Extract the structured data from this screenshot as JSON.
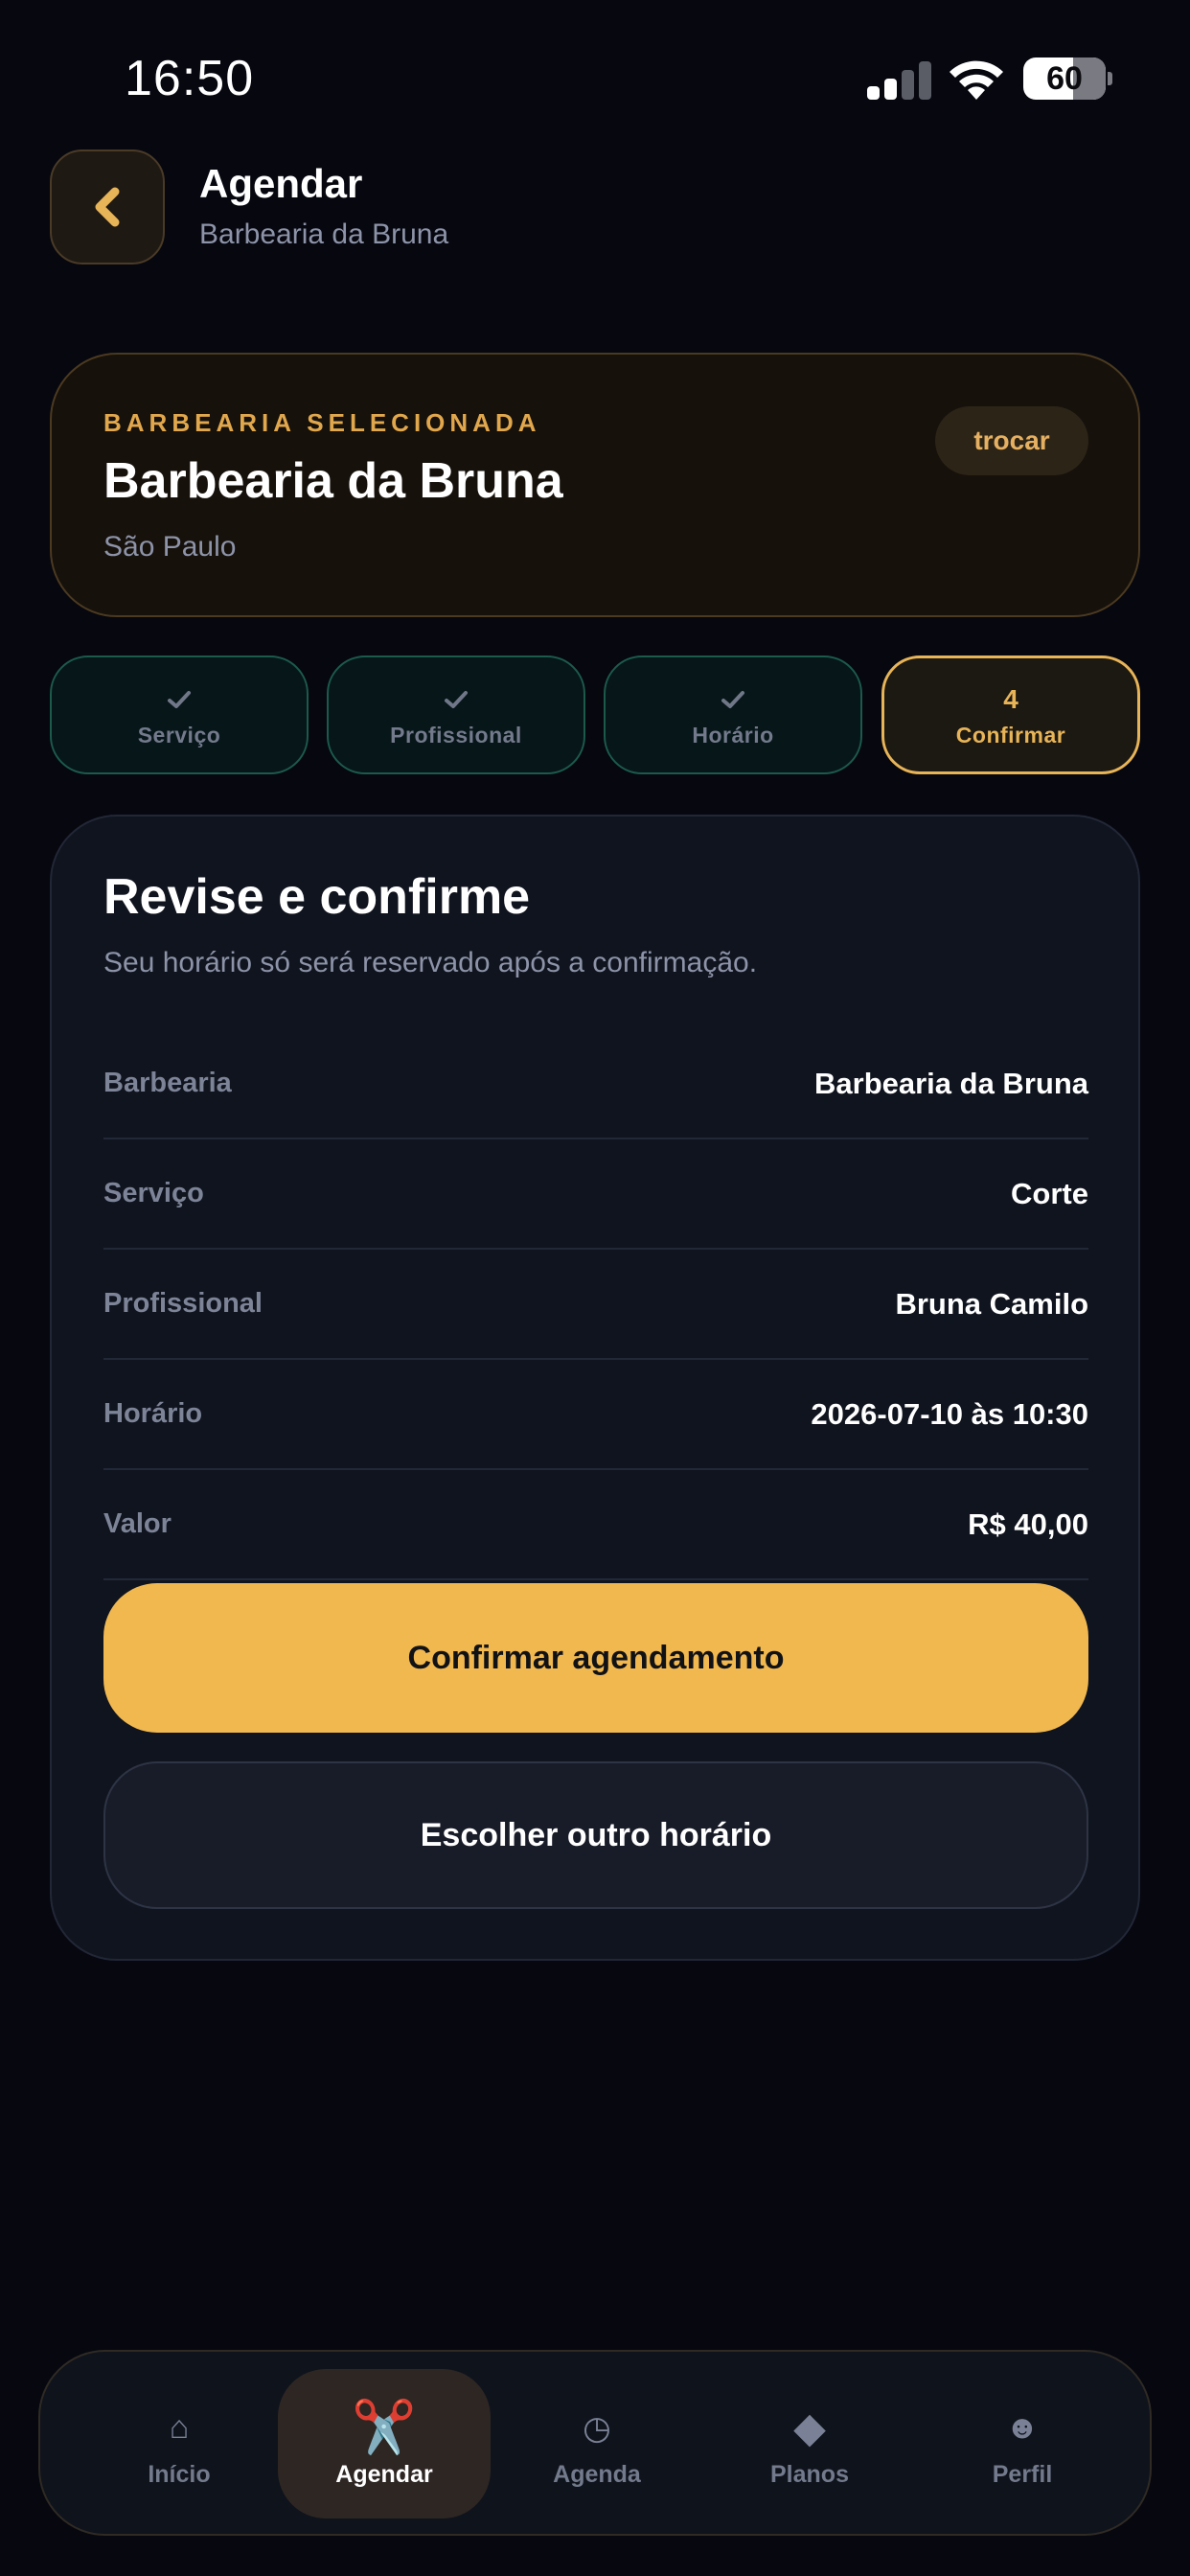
{
  "status_bar": {
    "time": "16:50",
    "battery": "60",
    "battery_level": 0.6
  },
  "header": {
    "title": "Agendar",
    "subtitle": "Barbearia da Bruna"
  },
  "selected_shop": {
    "eyebrow": "BARBEARIA SELECIONADA",
    "name": "Barbearia da Bruna",
    "city": "São Paulo",
    "swap_label": "trocar"
  },
  "steps": [
    {
      "label": "Serviço",
      "state": "done",
      "mark": "check-icon"
    },
    {
      "label": "Profissional",
      "state": "done",
      "mark": "check-icon"
    },
    {
      "label": "Horário",
      "state": "done",
      "mark": "check-icon"
    },
    {
      "label": "Confirmar",
      "state": "active",
      "number": "4"
    }
  ],
  "review": {
    "title": "Revise e confirme",
    "subtitle": "Seu horário só será reservado após a confirmação.",
    "rows": [
      {
        "label": "Barbearia",
        "value": "Barbearia da Bruna"
      },
      {
        "label": "Serviço",
        "value": "Corte"
      },
      {
        "label": "Profissional",
        "value": "Bruna Camilo"
      },
      {
        "label": "Horário",
        "value": "2026-07-10 às 10:30"
      },
      {
        "label": "Valor",
        "value": "R$ 40,00"
      }
    ],
    "confirm_label": "Confirmar agendamento",
    "other_label": "Escolher outro horário"
  },
  "nav": [
    {
      "label": "Início",
      "icon": "home-icon",
      "glyph": "⌂",
      "active": false
    },
    {
      "label": "Agendar",
      "icon": "scissors-icon",
      "glyph": "✂️",
      "active": true
    },
    {
      "label": "Agenda",
      "icon": "clock-icon",
      "glyph": "◷",
      "active": false
    },
    {
      "label": "Planos",
      "icon": "diamond-icon",
      "glyph": "◆",
      "active": false
    },
    {
      "label": "Perfil",
      "icon": "smiley-icon",
      "glyph": "☻",
      "active": false
    }
  ],
  "colors": {
    "background": "#06070f",
    "accent": "#f1b850",
    "success": "#1c5a4c",
    "muted": "#8d93a8"
  }
}
